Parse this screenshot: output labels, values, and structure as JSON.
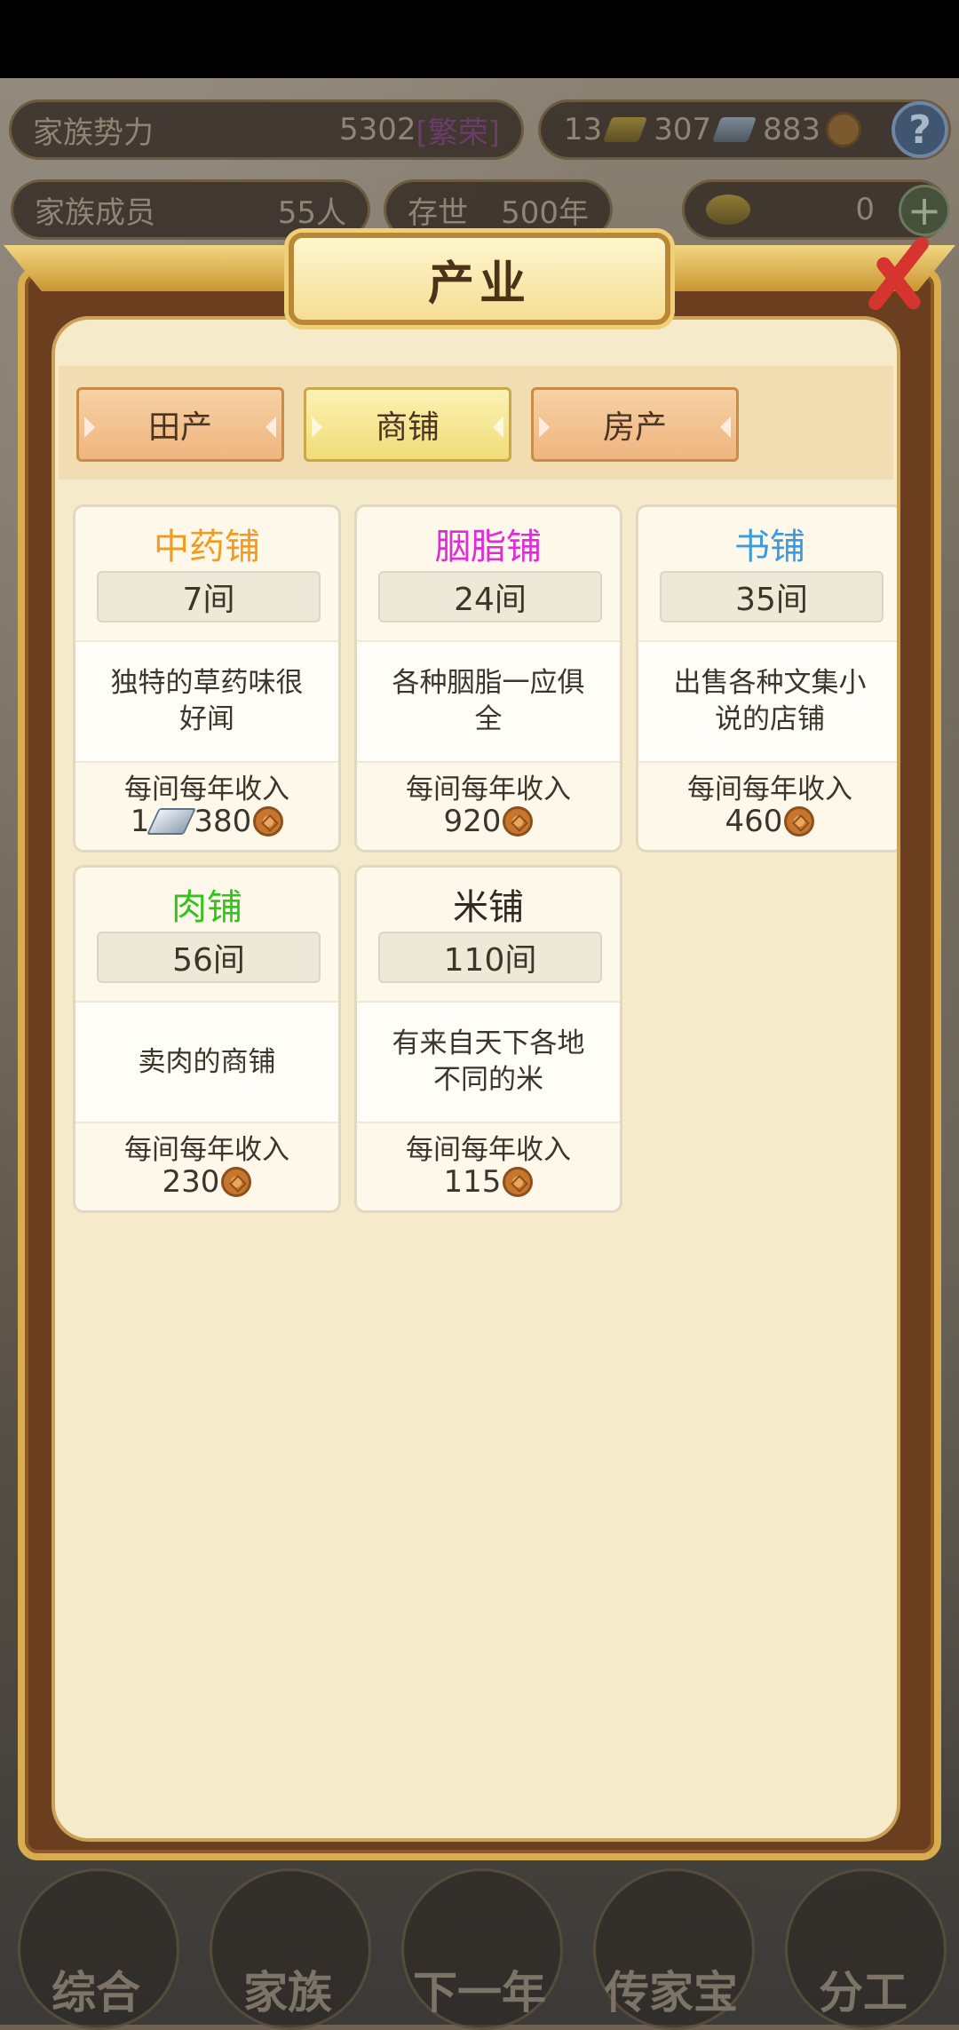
{
  "hud": {
    "power_label": "家族势力",
    "power_value": "5302",
    "power_tag": "[繁荣]",
    "gold": "13",
    "silver": "307",
    "copper": "883",
    "members_label": "家族成员",
    "members_value": "55人",
    "age_label": "存世",
    "age_value": "500年",
    "ingot_value": "0"
  },
  "dialog": {
    "title": "产业",
    "tabs": [
      "田产",
      "商铺",
      "房产"
    ],
    "active_tab": "商铺"
  },
  "shops": [
    {
      "name": "中药铺",
      "color": "#f39b1c",
      "count": "7间",
      "desc": "独特的草药味很好闻",
      "income_label": "每间每年收入",
      "income_silver": "1",
      "income_copper": "380"
    },
    {
      "name": "胭脂铺",
      "color": "#e02bd8",
      "count": "24间",
      "desc": "各种胭脂一应俱全",
      "income_label": "每间每年收入",
      "income_copper": "920"
    },
    {
      "name": "书铺",
      "color": "#3a9be0",
      "count": "35间",
      "desc": "出售各种文集小说的店铺",
      "income_label": "每间每年收入",
      "income_copper": "460"
    },
    {
      "name": "肉铺",
      "color": "#34c21d",
      "count": "56间",
      "desc": "卖肉的商铺",
      "income_label": "每间每年收入",
      "income_copper": "230"
    },
    {
      "name": "米铺",
      "color": "#2f2a24",
      "count": "110间",
      "desc": "有来自天下各地不同的米",
      "income_label": "每间每年收入",
      "income_copper": "115"
    }
  ],
  "bottom_nav": [
    "综合",
    "家族",
    "下一年",
    "传家宝",
    "分工"
  ]
}
